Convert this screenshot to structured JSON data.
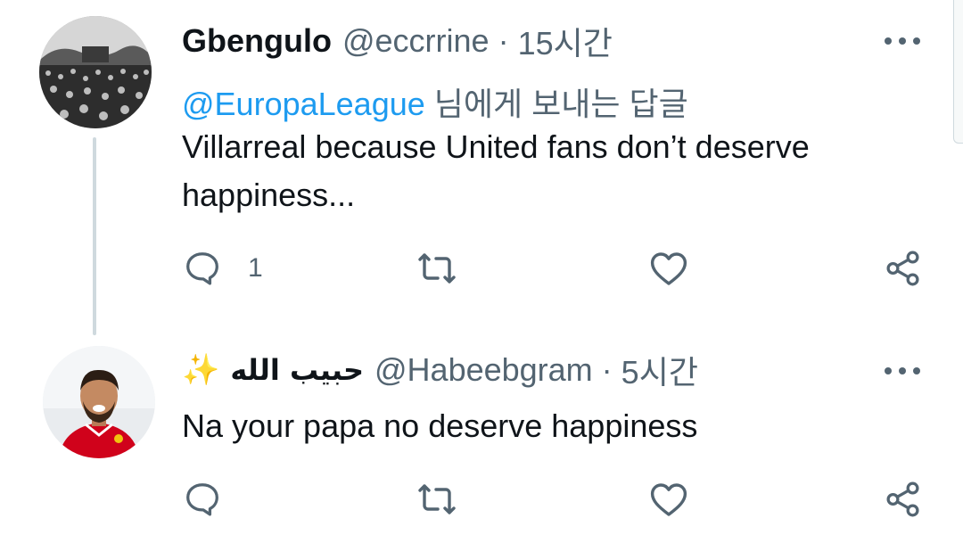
{
  "tweets": [
    {
      "display_name": "Gbengulo",
      "handle": "@eccrrine",
      "separator": "·",
      "time": "15시간",
      "reply_mention": "@EuropaLeague",
      "reply_suffix": " 님에게 보내는 답글",
      "text_line1": "Villarreal because United fans don’t deserve",
      "text_line2": "happiness...",
      "reply_count": "1",
      "avatar_icon": "crowd-photo-avatar"
    },
    {
      "name_emoji": "✨",
      "display_name": "حبيب الله",
      "handle": "@Habeebgram",
      "separator": "·",
      "time": "5시간",
      "text_line1": "Na your papa no deserve happiness",
      "reply_count": "",
      "avatar_icon": "footballer-photo-avatar"
    }
  ],
  "icons": [
    "reply-icon",
    "retweet-icon",
    "like-icon",
    "share-icon",
    "more-options-icon"
  ],
  "colors": {
    "text_primary": "#0f1419",
    "text_secondary": "#536471",
    "mention": "#1d9bf0",
    "thread_line": "#cfd9de"
  }
}
